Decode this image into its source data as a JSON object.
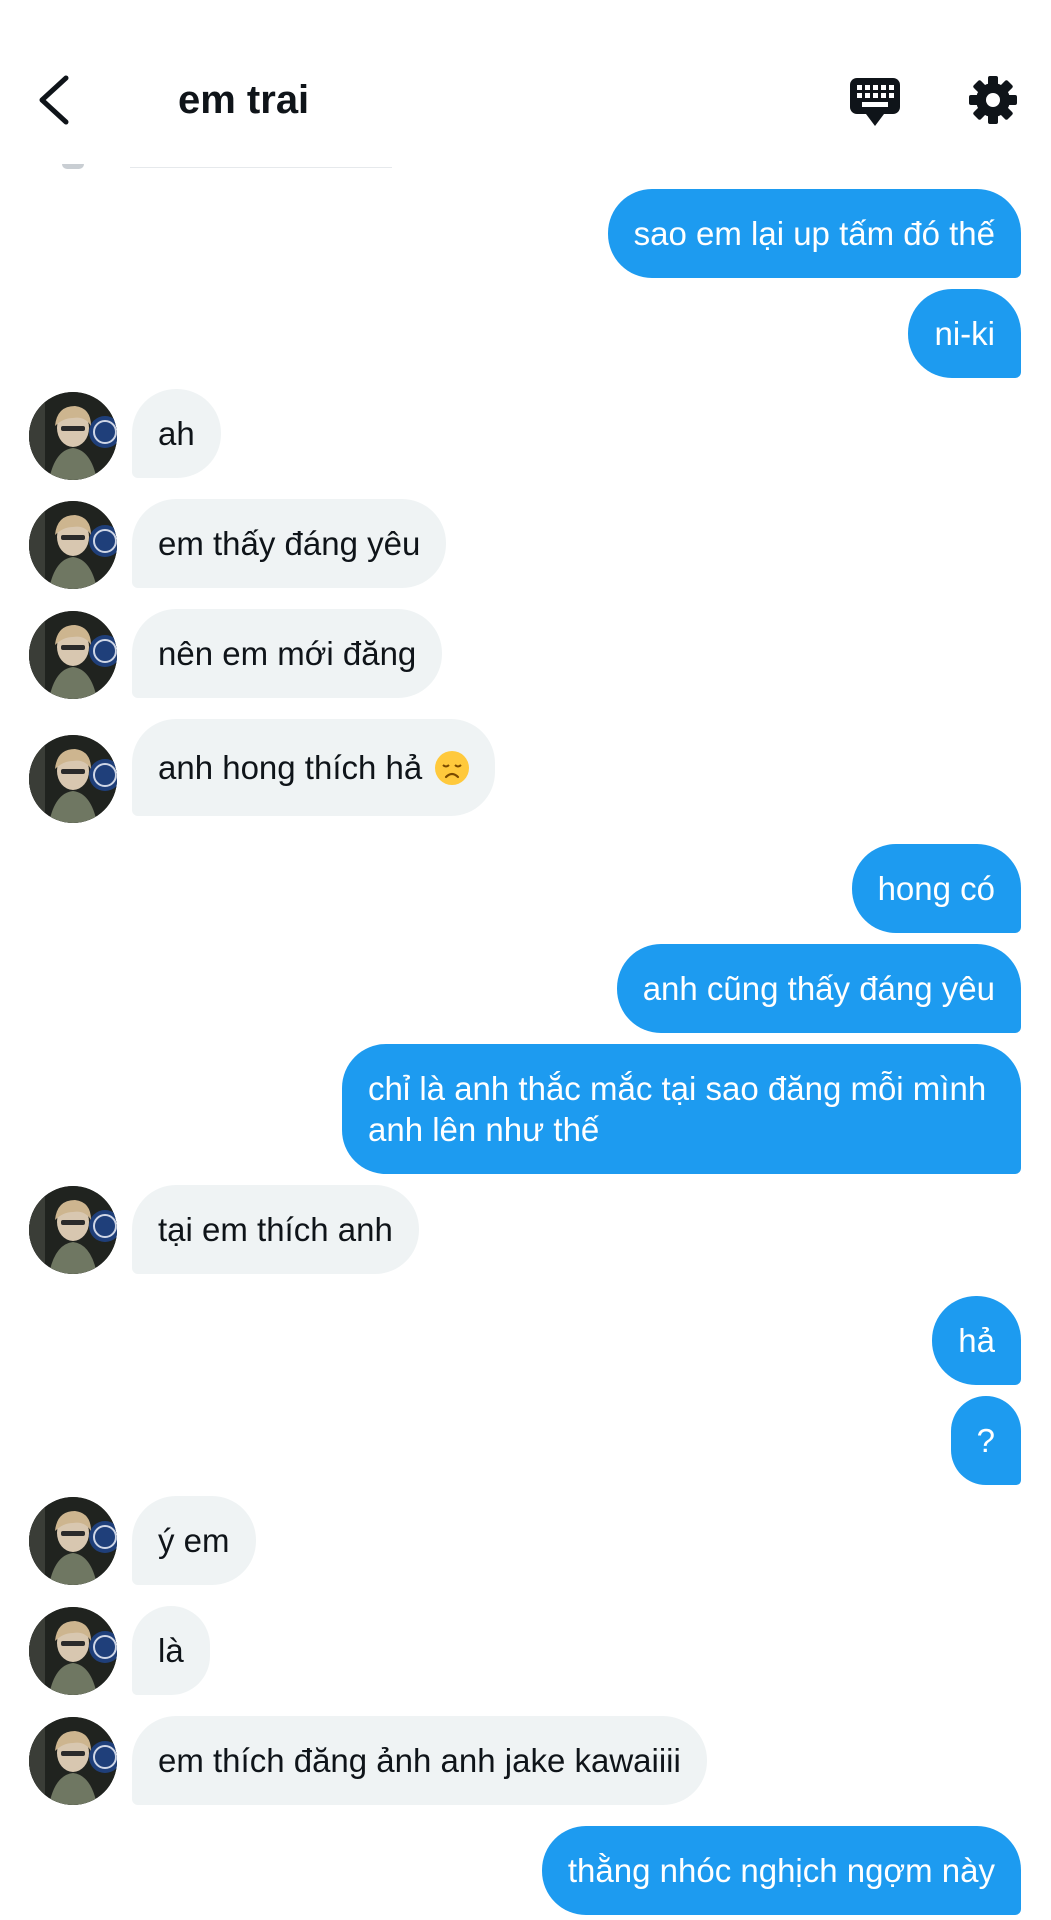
{
  "header": {
    "title": "em trai",
    "icons": [
      "back-arrow-icon",
      "keyboard-icon",
      "gear-icon"
    ]
  },
  "colors": {
    "sent_bubble": "#1d9bf0",
    "received_bubble": "#eff3f4",
    "text_dark": "#0f1419"
  },
  "messages": [
    {
      "from": "me",
      "text": "sao em lại up tấm đó thế"
    },
    {
      "from": "me",
      "text": "ni-ki"
    },
    {
      "from": "them",
      "text": "ah"
    },
    {
      "from": "them",
      "text": "em thấy đáng yêu"
    },
    {
      "from": "them",
      "text": "nên em mới đăng"
    },
    {
      "from": "them",
      "text": "anh hong thích hả",
      "emoji": "disappointed-face-emoji"
    },
    {
      "from": "me",
      "text": "hong có"
    },
    {
      "from": "me",
      "text": "anh cũng thấy đáng yêu"
    },
    {
      "from": "me",
      "text": "chỉ là anh thắc mắc tại sao đăng mỗi mình anh lên như thế"
    },
    {
      "from": "them",
      "text": "tại em thích anh"
    },
    {
      "from": "me",
      "text": "hả"
    },
    {
      "from": "me",
      "text": "?"
    },
    {
      "from": "them",
      "text": "ý em"
    },
    {
      "from": "them",
      "text": "là"
    },
    {
      "from": "them",
      "text": "em thích đăng ảnh anh jake kawaiiii"
    },
    {
      "from": "me",
      "text": "thằng nhóc nghịch ngợm này"
    }
  ]
}
